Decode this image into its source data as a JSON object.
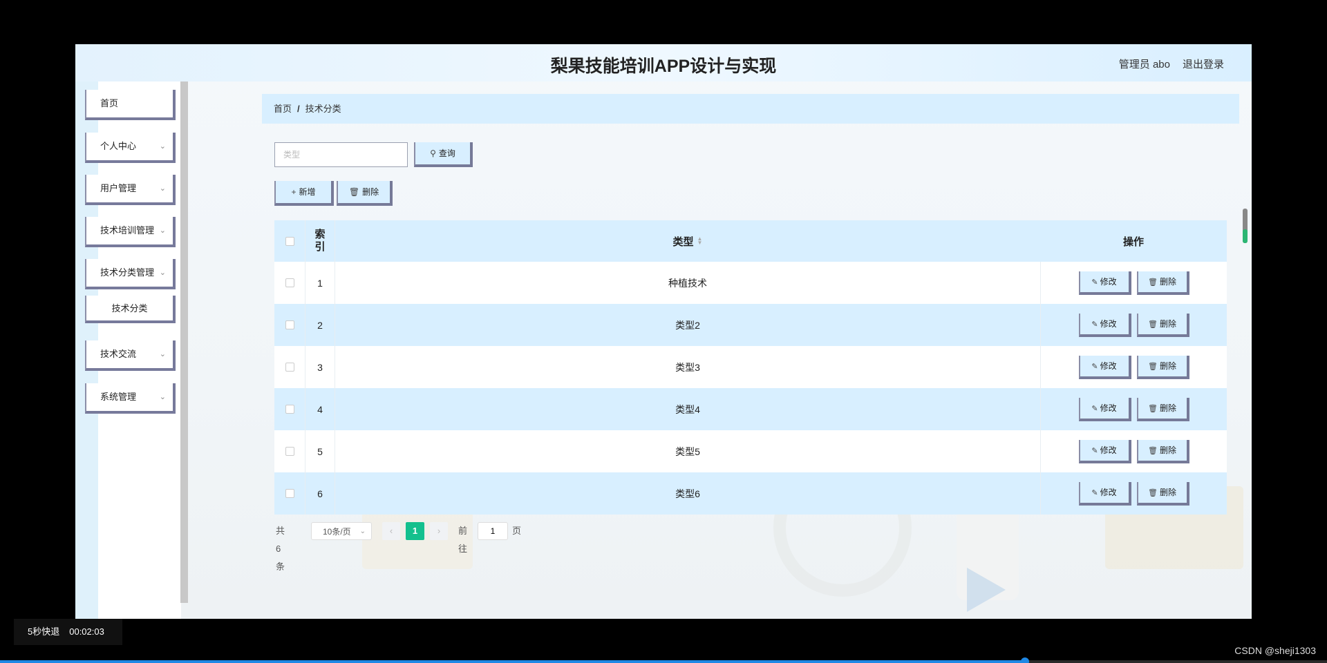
{
  "header": {
    "title": "梨果技能培训APP设计与实现",
    "user": "管理员 abo",
    "logout": "退出登录"
  },
  "sidebar": {
    "items": [
      {
        "label": "首页"
      },
      {
        "label": "个人中心"
      },
      {
        "label": "用户管理"
      },
      {
        "label": "技术培训管理"
      },
      {
        "label": "技术分类管理"
      },
      {
        "label": "技术分类"
      },
      {
        "label": "技术交流"
      },
      {
        "label": "系统管理"
      }
    ]
  },
  "breadcrumb": {
    "home": "首页",
    "separator": "/",
    "current": "技术分类"
  },
  "search": {
    "placeholder": "类型",
    "button": "查询"
  },
  "actions": {
    "add": "新增",
    "delete": "删除"
  },
  "table": {
    "columns": {
      "index_top": "索",
      "index_bottom": "引",
      "type": "类型",
      "operation": "操作"
    },
    "edit_label": "修改",
    "delete_label": "删除",
    "rows": [
      {
        "index": "1",
        "type": "种植技术"
      },
      {
        "index": "2",
        "type": "类型2"
      },
      {
        "index": "3",
        "type": "类型3"
      },
      {
        "index": "4",
        "type": "类型4"
      },
      {
        "index": "5",
        "type": "类型5"
      },
      {
        "index": "6",
        "type": "类型6"
      }
    ]
  },
  "pagination": {
    "total": "共 6 条",
    "page_size": "10条/页",
    "current_page": "1",
    "goto_label": "前往",
    "goto_value": "1",
    "page_suffix": "页"
  },
  "video": {
    "skip_label": "5秒快退",
    "time": "00:02:03",
    "credit": "CSDN @sheji1303"
  },
  "icons": {
    "search": "search-icon",
    "add": "plus-icon",
    "delete": "trash-icon",
    "edit": "edit-icon"
  },
  "colors": {
    "accent": "#d8efff",
    "page_active": "#14c08d",
    "button_border": "#767a98"
  }
}
